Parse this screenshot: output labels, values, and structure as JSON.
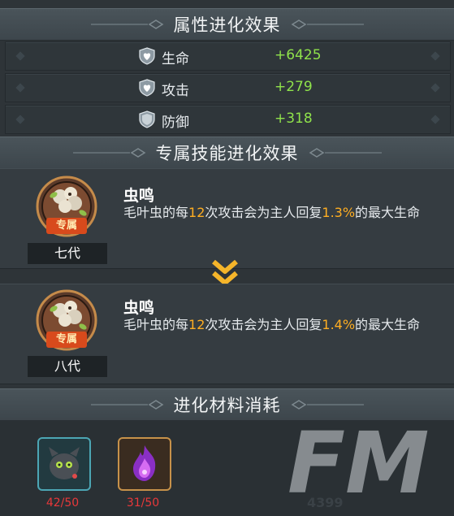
{
  "attr_section": {
    "title": "属性进化效果",
    "stats": [
      {
        "icon": "heart-shield-icon",
        "name": "生命",
        "value": "+6425"
      },
      {
        "icon": "heart-shield-icon",
        "name": "攻击",
        "value": "+279"
      },
      {
        "icon": "shield-icon",
        "name": "防御",
        "value": "+318"
      }
    ]
  },
  "skill_section": {
    "title": "专属技能进化效果",
    "before": {
      "badge_text": "专属",
      "generation": "七代",
      "name": "虫鸣",
      "desc_a": "毛叶虫的每",
      "hits": "12",
      "desc_b": "次攻击会为主人回复",
      "percent": "1.3%",
      "desc_c": "的最大生命"
    },
    "after": {
      "badge_text": "专属",
      "generation": "八代",
      "name": "虫鸣",
      "desc_a": "毛叶虫的每",
      "hits": "12",
      "desc_b": "次攻击会为主人回复",
      "percent": "1.4%",
      "desc_c": "的最大生命"
    }
  },
  "material_section": {
    "title": "进化材料消耗",
    "materials": [
      {
        "icon": "dark-pet-icon",
        "count": "42/50"
      },
      {
        "icon": "purple-flame-icon",
        "count": "31/50"
      }
    ]
  },
  "watermark": {
    "letters": "FM",
    "number": "4399"
  },
  "colors": {
    "bonus_green": "#8fe24b",
    "highlight_orange": "#ffae22",
    "insufficient_red": "#e8383a"
  }
}
